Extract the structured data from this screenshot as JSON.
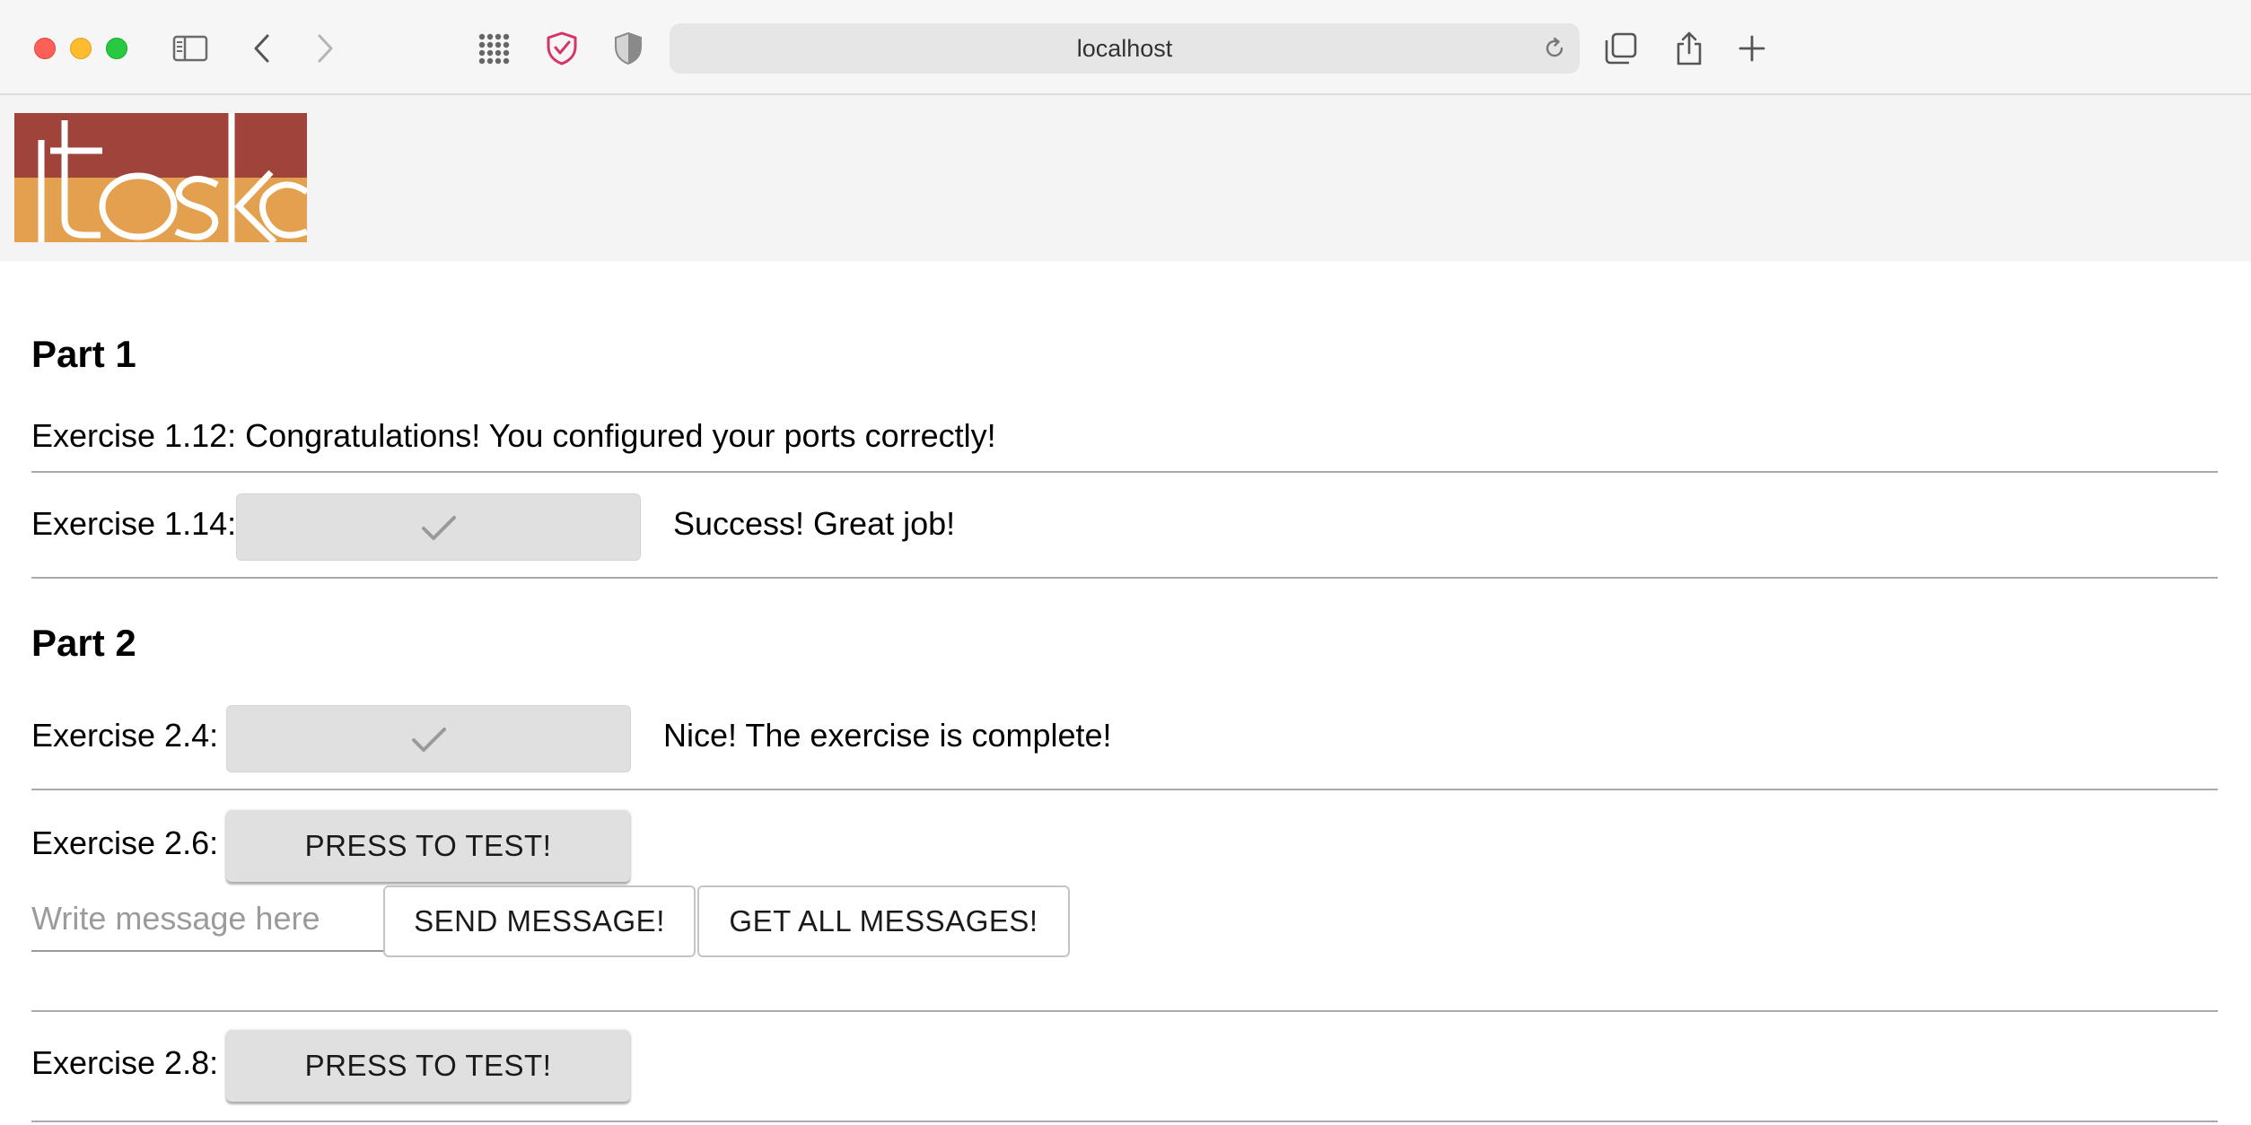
{
  "browser": {
    "url": "localhost"
  },
  "header": {
    "logo_text": "itoska",
    "logo_colors": {
      "top": "#a0443b",
      "bottom": "#e3a04f"
    }
  },
  "part1": {
    "title": "Part 1",
    "ex_1_12": {
      "label": "Exercise 1.12: Congratulations! You configured your ports correctly!"
    },
    "ex_1_14": {
      "label": "Exercise 1.14:",
      "status": "Success! Great job!"
    }
  },
  "part2": {
    "title": "Part 2",
    "ex_2_4": {
      "label": "Exercise 2.4:",
      "status": "Nice! The exercise is complete!"
    },
    "ex_2_6": {
      "label": "Exercise 2.6:",
      "test_button": "PRESS TO TEST!",
      "message_placeholder": "Write message here",
      "send_button": "SEND MESSAGE!",
      "get_all_button": "GET ALL MESSAGES!"
    },
    "ex_2_8": {
      "label": "Exercise 2.8:",
      "test_button": "PRESS TO TEST!"
    }
  }
}
